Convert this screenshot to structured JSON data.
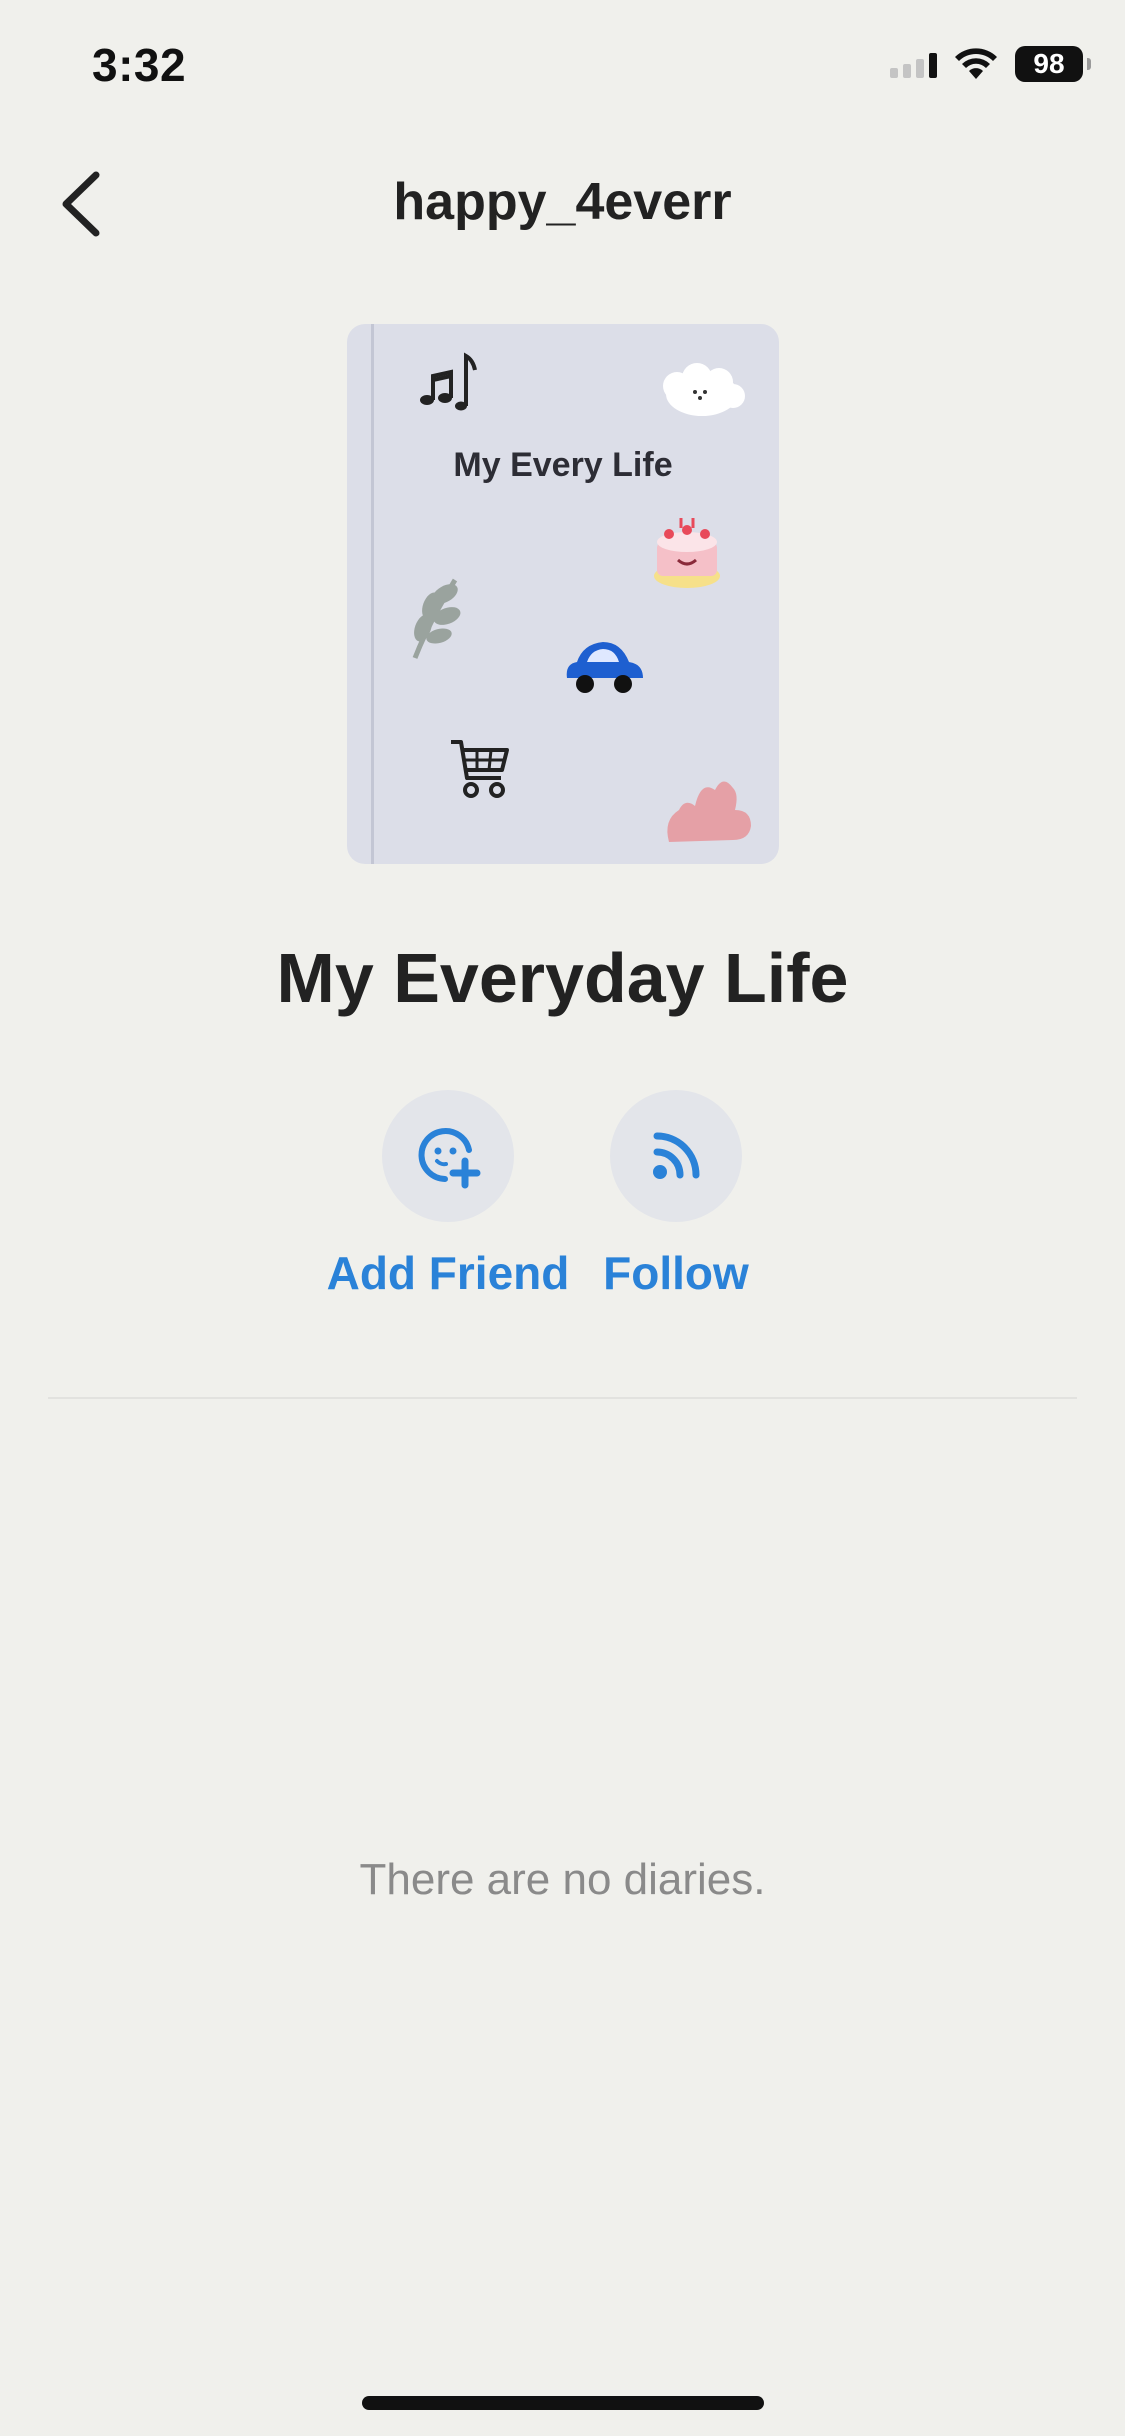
{
  "status_bar": {
    "time": "3:32",
    "battery": "98",
    "icons": [
      "cellular-signal-icon",
      "wifi-icon",
      "battery-icon"
    ]
  },
  "nav": {
    "title": "happy_4everr",
    "back_icon": "chevron-left-icon"
  },
  "cover": {
    "title": "My Every Life",
    "stickers": [
      "music-notes-icon",
      "cloud-dog-icon",
      "cake-icon",
      "leaf-icon",
      "car-icon",
      "shopping-cart-icon",
      "pink-plant-icon"
    ]
  },
  "diary": {
    "title": "My Everyday Life"
  },
  "actions": {
    "add_friend": {
      "label": "Add Friend",
      "icon": "add-friend-icon"
    },
    "follow": {
      "label": "Follow",
      "icon": "rss-icon"
    }
  },
  "empty_state": "There are no diaries.",
  "colors": {
    "background": "#f0f0ec",
    "accent": "#2a82d8",
    "cover": "#dcdee8",
    "action_circle": "#e3e5ea",
    "muted_text": "#8a8a8a"
  }
}
